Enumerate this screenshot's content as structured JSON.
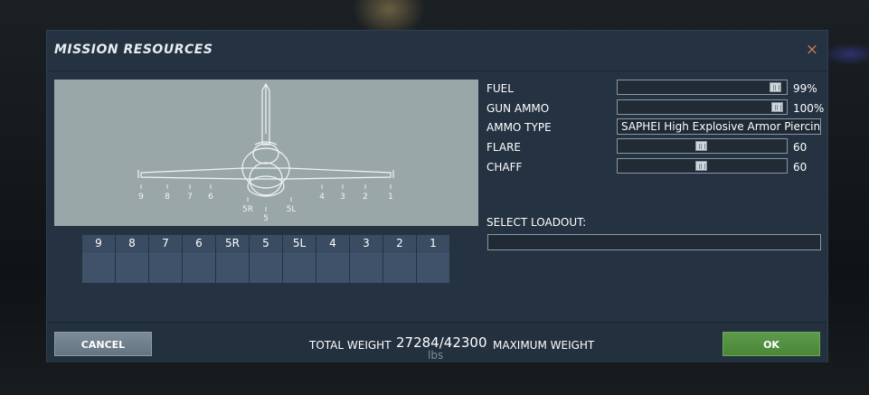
{
  "dialog": {
    "title": "MISSION RESOURCES",
    "close_glyph": "×"
  },
  "aircraft_preview": {
    "pylon_markers": [
      "9",
      "8",
      "7",
      "6",
      "5R",
      "5",
      "5L",
      "4",
      "3",
      "2",
      "1"
    ]
  },
  "pylons": [
    "9",
    "8",
    "7",
    "6",
    "5R",
    "5",
    "5L",
    "4",
    "3",
    "2",
    "1"
  ],
  "resources": {
    "fuel": {
      "label": "FUEL",
      "value": "99%",
      "level": 0.99
    },
    "gun_ammo": {
      "label": "GUN AMMO",
      "value": "100%",
      "level": 1.0
    },
    "ammo_type": {
      "label": "AMMO TYPE",
      "value": "SAPHEI High Explosive Armor Piercing P"
    },
    "flare": {
      "label": "FLARE",
      "value": "60",
      "level": 0.5
    },
    "chaff": {
      "label": "CHAFF",
      "value": "60",
      "level": 0.5
    }
  },
  "loadout": {
    "label": "SELECT LOADOUT:",
    "value": ""
  },
  "footer": {
    "cancel_label": "CANCEL",
    "total_weight_label": "TOTAL WEIGHT",
    "weight_value": "27284/42300",
    "weight_unit": "lbs",
    "max_weight_label": "MAXIMUM WEIGHT",
    "ok_label": "OK"
  },
  "colors": {
    "dialog_bg": "#243241",
    "preview_bg": "#9aa7a8",
    "close_accent": "#c87a50",
    "ok_green": "#4b8639",
    "cancel_gray": "#6e7d89"
  }
}
